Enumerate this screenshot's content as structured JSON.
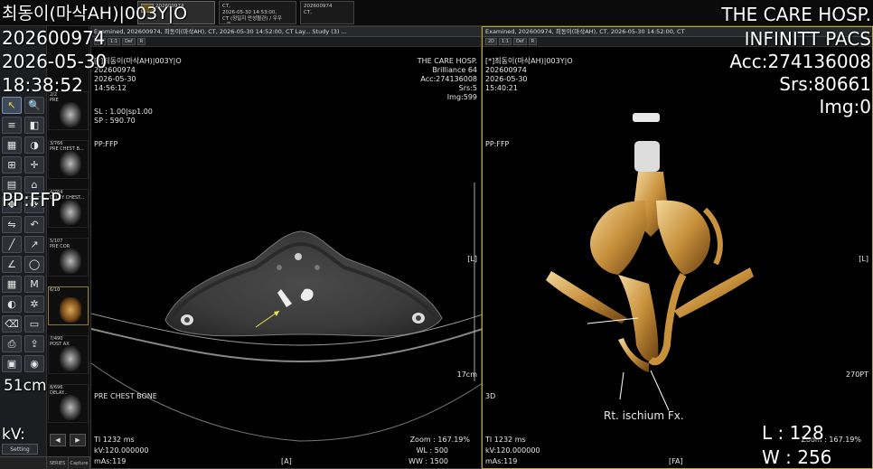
{
  "topbar": {
    "tabs": [
      {
        "line1": "202600974",
        "line2": "",
        "line3": "",
        "active": true
      },
      {
        "line1": "CT,",
        "line2": "2026-05-30 14:53:00,",
        "line3": "CT (정밀지 만성혈관) / 우우+흉...",
        "active": false
      },
      {
        "line1": "202600974",
        "line2": "CT,",
        "line3": "",
        "active": false
      }
    ]
  },
  "global_overlay": {
    "patient_line": "최동이(마삭AH)|003Y|O",
    "patient_id": "202600974",
    "date": "2026-05-30",
    "time": "18:38:52",
    "pp": "PP:FFP",
    "scale_label": "51cm",
    "kv_label": "kV:",
    "hospital": "THE CARE HOSP.",
    "system": "INFINITT PACS",
    "accession": "Acc:274136008",
    "series": "Srs:80661",
    "image": "Img:0",
    "level": "L : 128",
    "width": "W : 256"
  },
  "tools": {
    "buttons": [
      {
        "name": "pointer-tool-icon",
        "glyph": "↖",
        "selected": true,
        "yellow": true
      },
      {
        "name": "zoom-tool-icon",
        "glyph": "🔍",
        "selected": false,
        "yellow": false
      },
      {
        "name": "text-tool-icon",
        "glyph": "≡",
        "selected": false,
        "yellow": false
      },
      {
        "name": "window-level-icon",
        "glyph": "◧",
        "selected": false,
        "yellow": false
      },
      {
        "name": "layout-icon",
        "glyph": "▦",
        "selected": false,
        "yellow": false
      },
      {
        "name": "contrast-icon",
        "glyph": "◑",
        "selected": false,
        "yellow": false
      },
      {
        "name": "measure-icon",
        "glyph": "⊞",
        "selected": false,
        "yellow": false
      },
      {
        "name": "crosshair-icon",
        "glyph": "✛",
        "selected": false,
        "yellow": false
      },
      {
        "name": "stack-icon",
        "glyph": "▤",
        "selected": false,
        "yellow": false
      },
      {
        "name": "reset-icon",
        "glyph": "⌂",
        "selected": false,
        "yellow": false
      },
      {
        "name": "pan-icon",
        "glyph": "✥",
        "selected": false,
        "yellow": false
      },
      {
        "name": "rotate-icon",
        "glyph": "⟳",
        "selected": false,
        "yellow": false
      },
      {
        "name": "flip-icon",
        "glyph": "⇋",
        "selected": false,
        "yellow": false
      },
      {
        "name": "undo-icon",
        "glyph": "↶",
        "selected": false,
        "yellow": false
      },
      {
        "name": "ruler-icon",
        "glyph": "╱",
        "selected": false,
        "yellow": false
      },
      {
        "name": "arrow-icon",
        "glyph": "↗",
        "selected": false,
        "yellow": false
      },
      {
        "name": "angle-icon",
        "glyph": "∠",
        "selected": false,
        "yellow": false
      },
      {
        "name": "roi-icon",
        "glyph": "◯",
        "selected": false,
        "yellow": false
      },
      {
        "name": "grid-icon",
        "glyph": "▦",
        "selected": false,
        "yellow": false
      },
      {
        "name": "mpr-icon",
        "glyph": "M",
        "selected": false,
        "yellow": false
      },
      {
        "name": "key-image-icon",
        "glyph": "◐",
        "selected": false,
        "yellow": false
      },
      {
        "name": "cine-icon",
        "glyph": "✲",
        "selected": false,
        "yellow": false
      },
      {
        "name": "eraser-icon",
        "glyph": "⌫",
        "selected": false,
        "yellow": false
      },
      {
        "name": "film-icon",
        "glyph": "▭",
        "selected": false,
        "yellow": false
      },
      {
        "name": "print-icon",
        "glyph": "⎙",
        "selected": false,
        "yellow": false
      },
      {
        "name": "export-icon",
        "glyph": "⇪",
        "selected": false,
        "yellow": false
      },
      {
        "name": "save-icon",
        "glyph": "▣",
        "selected": false,
        "yellow": false
      },
      {
        "name": "camera-icon",
        "glyph": "◉",
        "selected": false,
        "yellow": false
      }
    ],
    "setting_label": "Setting",
    "series_tab": "SERIES",
    "capture_tab": "Capture"
  },
  "thumbnails": [
    {
      "label": "2/2",
      "label2": "PRE"
    },
    {
      "label": "3/766",
      "label2": "PRE CHEST B..."
    },
    {
      "label": "4/764",
      "label2": "DELAY CHEST..."
    },
    {
      "label": "5/107",
      "label2": "PRE COR"
    },
    {
      "label": "6/10",
      "label2": ""
    },
    {
      "label": "7/490",
      "label2": "POST AX"
    },
    {
      "label": "8/696",
      "label2": "DELAY..."
    }
  ],
  "viewport_left": {
    "header": "Examined, 202600974, 최동이(마삭AH), CT, 2026-05-30 14:52:00, CT   Lay...   Study  (3) ...",
    "patient": "[*]최동이(마삭AH)|003Y|O",
    "id": "202600974",
    "date": "2026-05-30",
    "time": "14:56:12",
    "sl": "SL : 1.00|sp1.00",
    "sp": "SP : 590.70",
    "pp": "PP:FFP",
    "hospital": "THE CARE HOSP.",
    "scanner": "Brilliance 64",
    "acc": "Acc:274136008",
    "srs": "Srs:5",
    "img": "Img:599",
    "orient_right": "[L]",
    "scale": "17cm",
    "series_name": "PRE CHEST BONE",
    "ti": "TI 1232 ms",
    "kv": "kV:120.000000",
    "mas": "mAs:119",
    "zoom": "Zoom : 167.19%",
    "wl": "WL : 500",
    "ww": "WW : 1500",
    "orient_bottom": "[A]"
  },
  "viewport_right": {
    "header": "Examined, 202600974, 최동이(마삭AH), CT, 2026-05-30 14:52:00, CT",
    "patient": "[*]최동이(마삭AH)|003Y|O",
    "id": "202600974",
    "date": "2026-05-30",
    "time": "15:40:21",
    "pp": "PP:FFP",
    "orient_right": "[L]",
    "scale": "270PT",
    "mode": "3D",
    "annotation": "Rt. ischium Fx.",
    "ti": "TI 1232 ms",
    "kv": "kV:120.000000",
    "mas": "mAs:119",
    "zoom": "Zoom : 167.19%",
    "orient_bottom": "[FA]"
  }
}
